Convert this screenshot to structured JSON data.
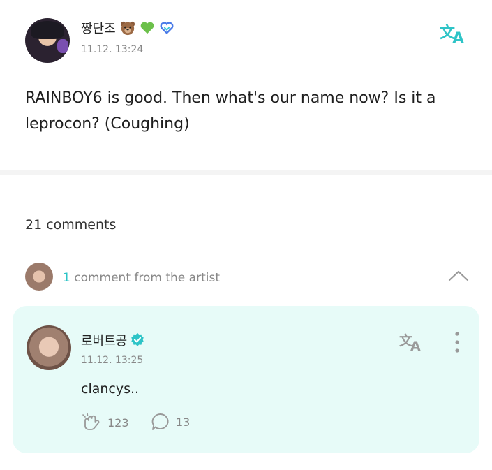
{
  "post": {
    "author": "짱단조",
    "date": "11.12. 13:24",
    "body": "RAINBOY6 is good. Then what's our name now? Is it a leprocon? (Coughing)",
    "author_emojis": [
      "bear-face-icon",
      "green-heart-icon",
      "weverse-heart-icon"
    ]
  },
  "comments": {
    "count_label": "21 comments",
    "artist_summary_count": "1",
    "artist_summary_text": "comment from the artist"
  },
  "artist_comment": {
    "author": "로버트공",
    "date": "11.12. 13:25",
    "text": "clancys..",
    "likes": "123",
    "replies": "13"
  },
  "colors": {
    "accent": "#2ec4c7",
    "card_background": "#e7fbf8",
    "muted_text": "#888888"
  }
}
